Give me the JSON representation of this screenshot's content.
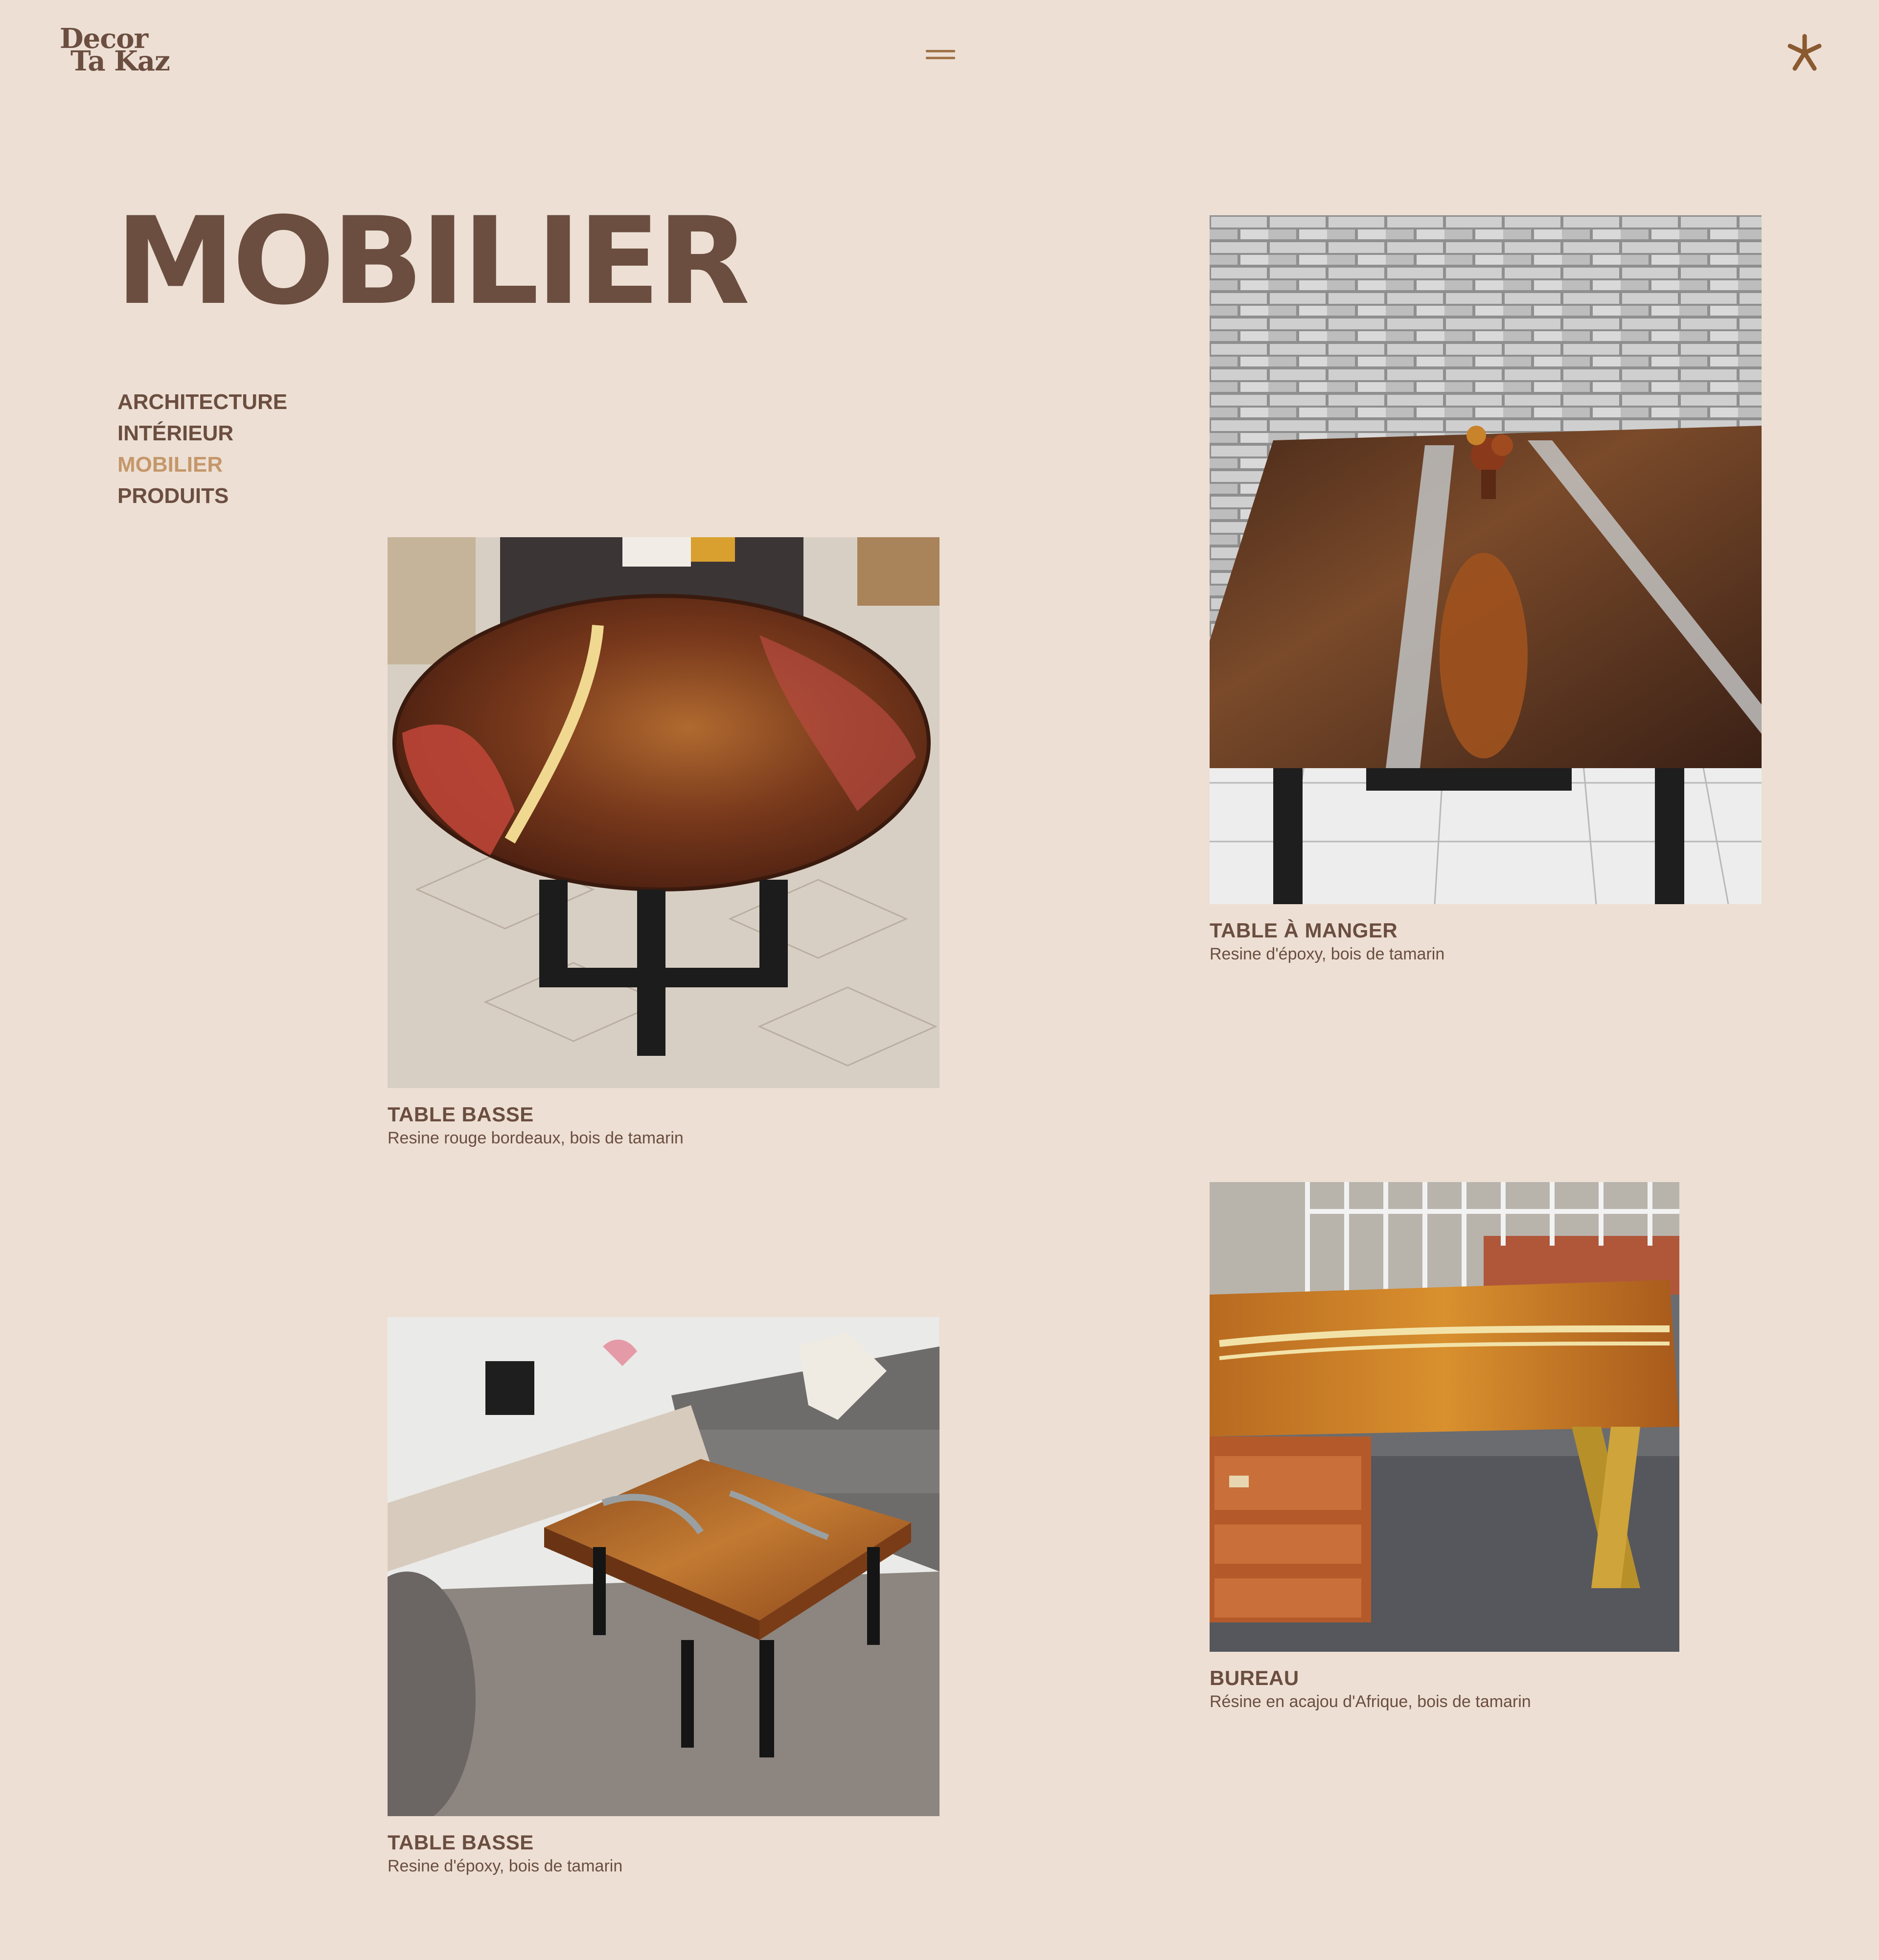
{
  "header": {
    "logo_line1": "Decor",
    "logo_line2": "Ta Kaz",
    "menu_icon": "hamburger-menu-icon",
    "right_icon": "asterisk-icon"
  },
  "page": {
    "title": "MOBILIER"
  },
  "nav": {
    "items": [
      {
        "label": "ARCHITECTURE",
        "active": false
      },
      {
        "label": "INTÉRIEUR",
        "active": false
      },
      {
        "label": "MOBILIER",
        "active": true
      },
      {
        "label": "PRODUITS",
        "active": false
      }
    ]
  },
  "products": [
    {
      "title": "TABLE À MANGER",
      "description": "Resine d'époxy, bois de tamarin"
    },
    {
      "title": "TABLE BASSE",
      "description": "Resine rouge bordeaux, bois de tamarin"
    },
    {
      "title": "BUREAU",
      "description": "Résine en acajou d'Afrique, bois de tamarin"
    },
    {
      "title": "TABLE BASSE",
      "description": "Resine d'époxy, bois de tamarin"
    }
  ],
  "colors": {
    "background": "#eddfd4",
    "text": "#6b4e40",
    "active": "#c4976a",
    "accent": "#a07346"
  }
}
